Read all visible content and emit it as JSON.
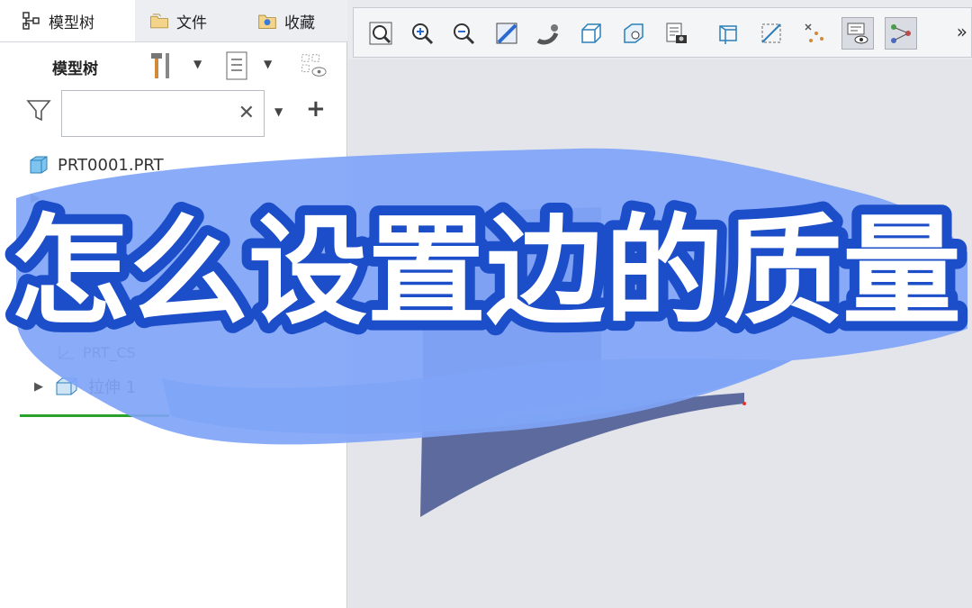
{
  "tabs": [
    {
      "label": "模型树",
      "icon": "model-tree-icon",
      "active": true
    },
    {
      "label": "文件",
      "icon": "folder-icon",
      "active": false
    },
    {
      "label": "收藏",
      "icon": "favorites-icon",
      "active": false
    }
  ],
  "tree_header": {
    "label": "模型树",
    "icons": [
      "tools-icon",
      "settings-list-icon",
      "show-hide-icon"
    ]
  },
  "search": {
    "placeholder": "",
    "value": ""
  },
  "tree": {
    "root": {
      "label": "PRT0001.PRT",
      "icon": "part-icon"
    },
    "partial_items": [
      {
        "label": "PRT_CS",
        "icon": "coordinate-system-icon"
      }
    ],
    "feature": {
      "label": "拉伸 1",
      "icon": "extrude-icon"
    }
  },
  "toolbar": {
    "buttons": [
      "zoom-fit-icon",
      "zoom-in-icon",
      "zoom-out-icon",
      "repaint-icon",
      "spin-center-icon",
      "display-style-icon",
      "saved-orientations-icon",
      "view-manager-icon",
      "perspective-icon",
      "section-icon",
      "datum-display-icon",
      "annotation-display-icon",
      "select-filter-icon"
    ],
    "more": "»"
  },
  "overlay": {
    "title": "怎么设置边的质量",
    "title_fill": "#ffffff",
    "title_outline": "#1c4ec9",
    "brush_color": "#7fa4f7"
  },
  "colors": {
    "model_face": "#5c6a9e",
    "model_top": "#6f7fc0",
    "accent_green": "#2aa12a"
  }
}
